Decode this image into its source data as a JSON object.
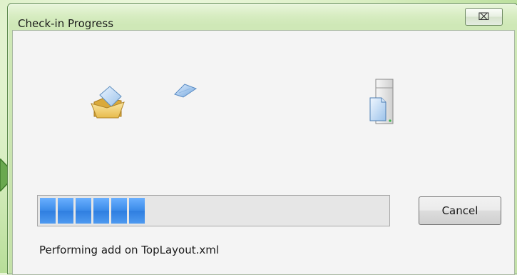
{
  "window": {
    "title": "Check-in Progress",
    "close_glyph": "⌧"
  },
  "icons": {
    "source": "open-folder-icon",
    "in_transit": "flying-document-icon",
    "destination": "server-document-icon"
  },
  "progress": {
    "segments_filled": 6,
    "value_fraction": 0.34,
    "accent_color": "#3a8ae8"
  },
  "buttons": {
    "cancel_label": "Cancel"
  },
  "status": {
    "text": "Performing add on TopLayout.xml"
  }
}
